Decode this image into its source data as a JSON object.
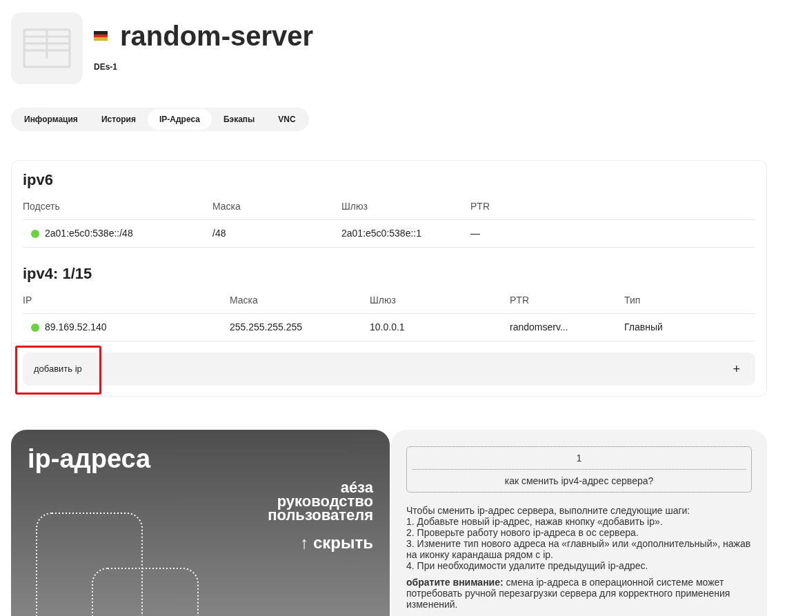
{
  "server": {
    "name": "random-server",
    "location": "DEs-1"
  },
  "tabs": [
    {
      "label": "Информация",
      "selected": false
    },
    {
      "label": "История",
      "selected": false
    },
    {
      "label": "IP-Адреса",
      "selected": true
    },
    {
      "label": "Бэкапы",
      "selected": false
    },
    {
      "label": "VNC",
      "selected": false
    }
  ],
  "ipv6": {
    "title": "ipv6",
    "columns": [
      "Подсеть",
      "Маска",
      "Шлюз",
      "PTR"
    ],
    "rows": [
      {
        "active": true,
        "cells": [
          "2a01:e5c0:538e::/48",
          "/48",
          "2a01:e5c0:538e::1",
          "—"
        ]
      }
    ]
  },
  "ipv4": {
    "title": "ipv4: 1/15",
    "columns": [
      "IP",
      "Маска",
      "Шлюз",
      "PTR",
      "Тип"
    ],
    "rows": [
      {
        "active": true,
        "cells": [
          "89.169.52.140",
          "255.255.255.255",
          "10.0.0.1",
          "randomserv...",
          "Главный"
        ]
      }
    ]
  },
  "add_ip": {
    "label": "добавить ip",
    "icon": "+",
    "highlighted": true
  },
  "guide": {
    "title": "ip-адреса",
    "brand": "аéза",
    "subtitle_lines": [
      "руководство",
      "пользователя"
    ],
    "hide": "↑ скрыть",
    "step_number": "1",
    "question": "как сменить ipv4-адрес сервера?",
    "intro": "Чтобы сменить ip-адрес сервера, выполните следующие шаги:",
    "steps": [
      "1. Добавьте новый ip-адрес, нажав кнопку «добавить ip».",
      "2. Проверьте работу нового ip-адреса в ос сервера.",
      "3. Измените тип нового адреса на «главный» или «дополнительный», нажав на иконку карандаша рядом с ip.",
      "4. При необходимости удалите предыдущий ip-адрес."
    ],
    "note": "**обратите внимание:** смена ip-адреса в операционной системе может потребовать ручной перезагрузки сервера для корректного применения изменений."
  }
}
